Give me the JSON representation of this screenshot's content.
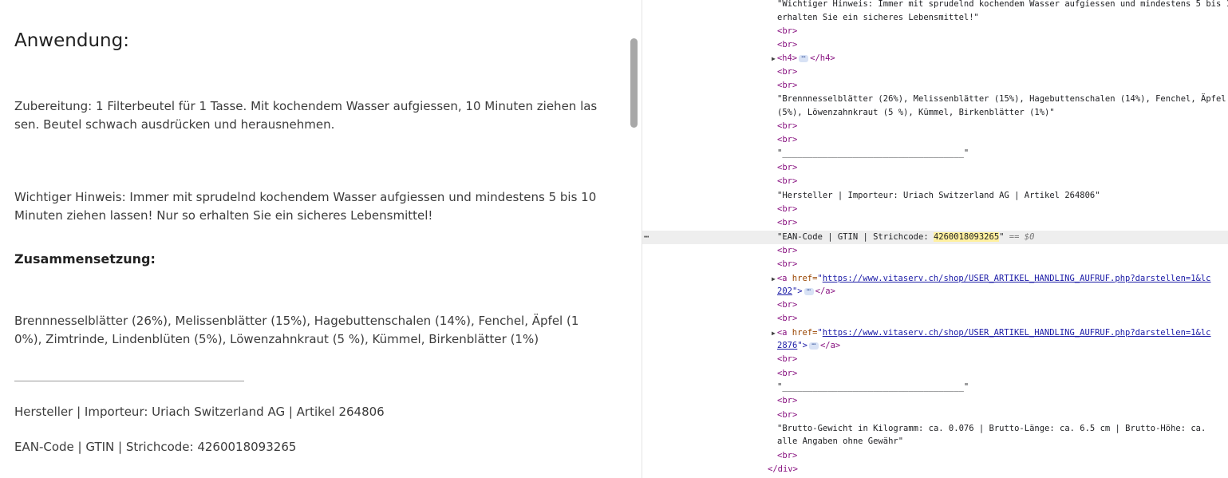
{
  "page": {
    "heading_application": "Anwendung:",
    "preparation": "Zubereitung: 1 Filterbeutel für 1 Tasse. Mit kochendem Wasser aufgiessen, 10 Minuten ziehen lassen. Beutel schwach ausdrücken und herausnehmen.",
    "important_note": "Wichtiger Hinweis: Immer mit sprudelnd kochendem Wasser aufgiessen und mindestens 5 bis 10 Minuten ziehen lassen! Nur so erhalten Sie ein sicheres Lebensmittel!",
    "heading_composition": "Zusammensetzung:",
    "composition": "Brennnesselblätter (26%), Melissenblätter (15%), Hagebuttenschalen (14%), Fenchel, Äpfel (10%), Zimtrinde, Lindenblüten (5%), Löwenzahnkraut (5 %), Kümmel, Birkenblätter (1%)",
    "manufacturer": "Hersteller | Importeur: Uriach Switzerland AG | Artikel 264806",
    "ean": "EAN-Code | GTIN | Strichcode: 4260018093265"
  },
  "devtools": {
    "br": "<br>",
    "div_close": "</div>",
    "h4_open": "<h4>",
    "h4_close": "</h4>",
    "a_open": "<a ",
    "a_close": "</a>",
    "href_attr": "href=",
    "dots": "⋯",
    "ellipsis": "⋯",
    "quote": "\"",
    "close_bracket": "\">",
    "text_hinweis_1": "\"Wichtiger Hinweis: Immer mit sprudelnd kochendem Wasser aufgiessen und mindestens 5 bis 10 Minuten ziehen lassen! Nur so",
    "text_hinweis_2": "erhalten Sie ein sicheres Lebensmittel!\"",
    "text_comp_1": "\"Brennnesselblätter (26%), Melissenblätter (15%), Hagebuttenschalen (14%), Fenchel, Äpfel (10%), Zimtrinde, Lindenblüten",
    "text_comp_2": "(5%), Löwenzahnkraut (5 %), Kümmel, Birkenblätter (1%)\"",
    "text_rule": "\"____________________________________\"",
    "text_manufacturer": "\"Hersteller | Importeur: Uriach Switzerland AG | Artikel 264806\"",
    "text_ean_prefix": "\"EAN-Code | GTIN | Strichcode: ",
    "text_ean_code": "4260018093265",
    "text_ean_suffix": "\"",
    "eq_marker": " == $0",
    "href_1": "https://www.vitaserv.ch/shop/USER_ARTIKEL_HANDLING_AUFRUF.php?darstellen=1&lc",
    "href_1_tail": "202",
    "href_2": "https://www.vitaserv.ch/shop/USER_ARTIKEL_HANDLING_AUFRUF.php?darstellen=1&lc",
    "href_2_tail": "2876",
    "text_weight_1": "\"Brutto-Gewicht in Kilogramm: ca. 0.076 | Brutto-Länge: ca. 6.5 cm | Brutto-Höhe: ca.",
    "text_weight_2": "alle Angaben ohne Gewähr\""
  }
}
